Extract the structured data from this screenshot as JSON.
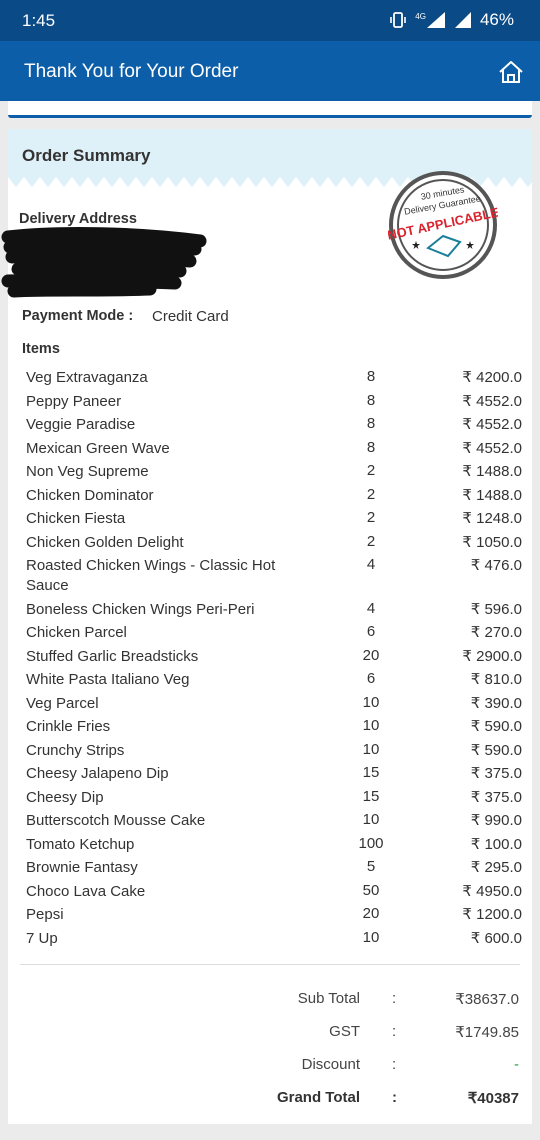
{
  "status": {
    "time": "1:45",
    "network": "4G",
    "battery": "46%"
  },
  "header": {
    "title": "Thank You for Your Order"
  },
  "summary": {
    "title": "Order Summary",
    "delivery_label": "Delivery Address",
    "payment_label": "Payment Mode :",
    "payment_value": "Credit Card",
    "items_label": "Items",
    "stamp": {
      "line1": "30 minutes",
      "line2": "Delivery Guarantee",
      "line3": "NOT APPLICABLE"
    }
  },
  "items": [
    {
      "name": "Veg Extravaganza",
      "qty": "8",
      "price": "₹ 4200.0"
    },
    {
      "name": "Peppy Paneer",
      "qty": "8",
      "price": "₹ 4552.0"
    },
    {
      "name": "Veggie Paradise",
      "qty": "8",
      "price": "₹ 4552.0"
    },
    {
      "name": "Mexican Green Wave",
      "qty": "8",
      "price": "₹ 4552.0"
    },
    {
      "name": "Non Veg Supreme",
      "qty": "2",
      "price": "₹ 1488.0"
    },
    {
      "name": "Chicken Dominator",
      "qty": "2",
      "price": "₹ 1488.0"
    },
    {
      "name": "Chicken Fiesta",
      "qty": "2",
      "price": "₹ 1248.0"
    },
    {
      "name": "Chicken Golden Delight",
      "qty": "2",
      "price": "₹ 1050.0"
    },
    {
      "name": "Roasted Chicken Wings - Classic Hot Sauce",
      "qty": "4",
      "price": "₹ 476.0"
    },
    {
      "name": "Boneless Chicken Wings Peri-Peri",
      "qty": "4",
      "price": "₹ 596.0"
    },
    {
      "name": "Chicken Parcel",
      "qty": "6",
      "price": "₹ 270.0"
    },
    {
      "name": "Stuffed Garlic Breadsticks",
      "qty": "20",
      "price": "₹ 2900.0"
    },
    {
      "name": "White Pasta Italiano Veg",
      "qty": "6",
      "price": "₹ 810.0"
    },
    {
      "name": "Veg Parcel",
      "qty": "10",
      "price": "₹ 390.0"
    },
    {
      "name": "Crinkle Fries",
      "qty": "10",
      "price": "₹ 590.0"
    },
    {
      "name": "Crunchy Strips",
      "qty": "10",
      "price": "₹ 590.0"
    },
    {
      "name": "Cheesy Jalapeno Dip",
      "qty": "15",
      "price": "₹ 375.0"
    },
    {
      "name": "Cheesy Dip",
      "qty": "15",
      "price": "₹ 375.0"
    },
    {
      "name": "Butterscotch Mousse Cake",
      "qty": "10",
      "price": "₹ 990.0"
    },
    {
      "name": "Tomato Ketchup",
      "qty": "100",
      "price": "₹ 100.0"
    },
    {
      "name": "Brownie Fantasy",
      "qty": "5",
      "price": "₹ 295.0"
    },
    {
      "name": " Choco Lava Cake",
      "qty": "50",
      "price": "₹ 4950.0"
    },
    {
      "name": "Pepsi",
      "qty": "20",
      "price": "₹ 1200.0"
    },
    {
      "name": "7 Up",
      "qty": "10",
      "price": "₹ 600.0"
    }
  ],
  "totals": {
    "subtotal_label": "Sub Total",
    "subtotal_value": "₹38637.0",
    "gst_label": "GST",
    "gst_value": "₹1749.85",
    "discount_label": "Discount",
    "discount_value": "-",
    "grand_label": "Grand Total",
    "grand_value": "₹40387",
    "colon": ":"
  },
  "colors": {
    "statusbar": "#0a4a86",
    "appbar": "#0d5ea8",
    "summary_band": "#dff1f8",
    "stamp_red": "#d9232e",
    "discount_green": "#2e9d3f"
  }
}
